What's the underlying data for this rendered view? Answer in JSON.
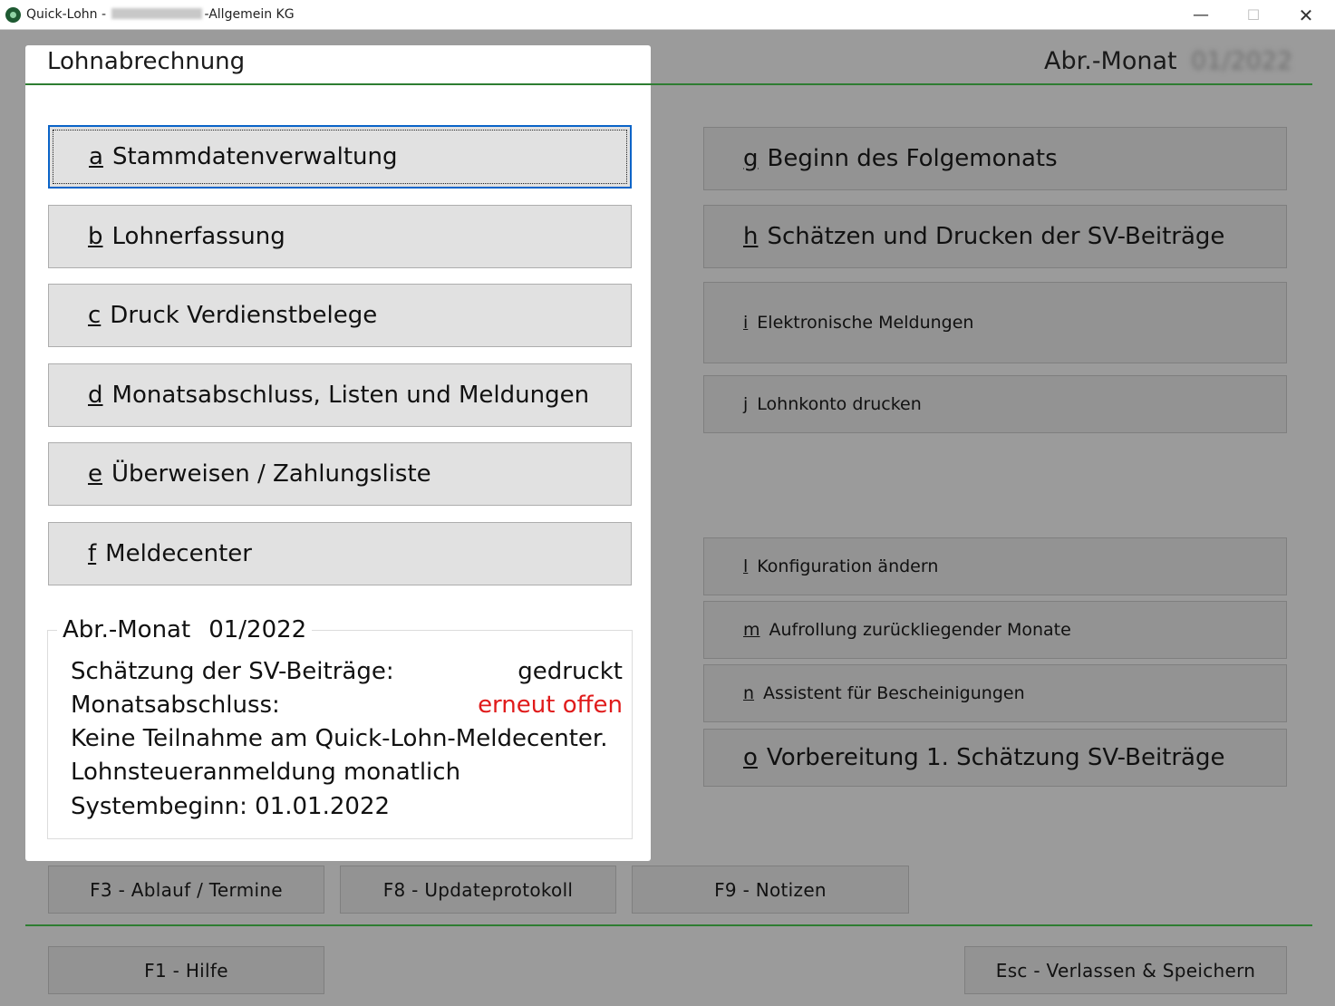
{
  "window": {
    "title_prefix": "Quick-Lohn - ",
    "title_suffix": "-Allgemein KG",
    "minimize": "—",
    "maximize": "☐",
    "close": "✕"
  },
  "header": {
    "abr_label": "Abr.-Monat",
    "abr_value": "01/2022"
  },
  "panel": {
    "title": "Lohnabrechnung",
    "buttons": [
      {
        "key": "a",
        "label": "Stammdatenverwaltung"
      },
      {
        "key": "b",
        "label": "Lohnerfassung"
      },
      {
        "key": "c",
        "label": "Druck Verdienstbelege"
      },
      {
        "key": "d",
        "label": "Monatsabschluss, Listen und Meldungen"
      },
      {
        "key": "e",
        "label": "Überweisen / Zahlungsliste"
      },
      {
        "key": "f",
        "label": "Meldecenter"
      }
    ],
    "info": {
      "legend_label": "Abr.-Monat",
      "legend_value": "01/2022",
      "sv_label": "Schätzung der SV-Beiträge:",
      "sv_value": "gedruckt",
      "ma_label": "Monatsabschluss:",
      "ma_value": "erneut offen",
      "line3": "Keine Teilnahme am Quick-Lohn-Meldecenter.",
      "line4": "Lohnsteueranmeldung monatlich",
      "line5": "Systembeginn: 01.01.2022"
    }
  },
  "right_buttons": [
    {
      "key": "g",
      "label": "Beginn des Folgemonats"
    },
    {
      "key": "h",
      "label": "Schätzen und Drucken der SV-Beiträge"
    },
    {
      "key": "i",
      "label": "Elektronische Meldungen"
    },
    {
      "key": "j",
      "label": "Lohnkonto drucken"
    },
    {
      "key": "l",
      "label": "Konfiguration ändern"
    },
    {
      "key": "m",
      "label": "Aufrollung zurückliegender Monate"
    },
    {
      "key": "n",
      "label": "Assistent für Bescheinigungen"
    },
    {
      "key": "o",
      "label": "Vorbereitung 1. Schätzung SV-Beiträge"
    }
  ],
  "fkeys": {
    "f3": "F3 - Ablauf / Termine",
    "f8": "F8 - Updateprotokoll",
    "f9": "F9 - Notizen",
    "f1": "F1 - Hilfe",
    "esc": "Esc - Verlassen & Speichern"
  },
  "colors": {
    "accent_line": "#2e7d32",
    "status_red": "#e01b1b",
    "focus_border": "#0a64c8"
  }
}
